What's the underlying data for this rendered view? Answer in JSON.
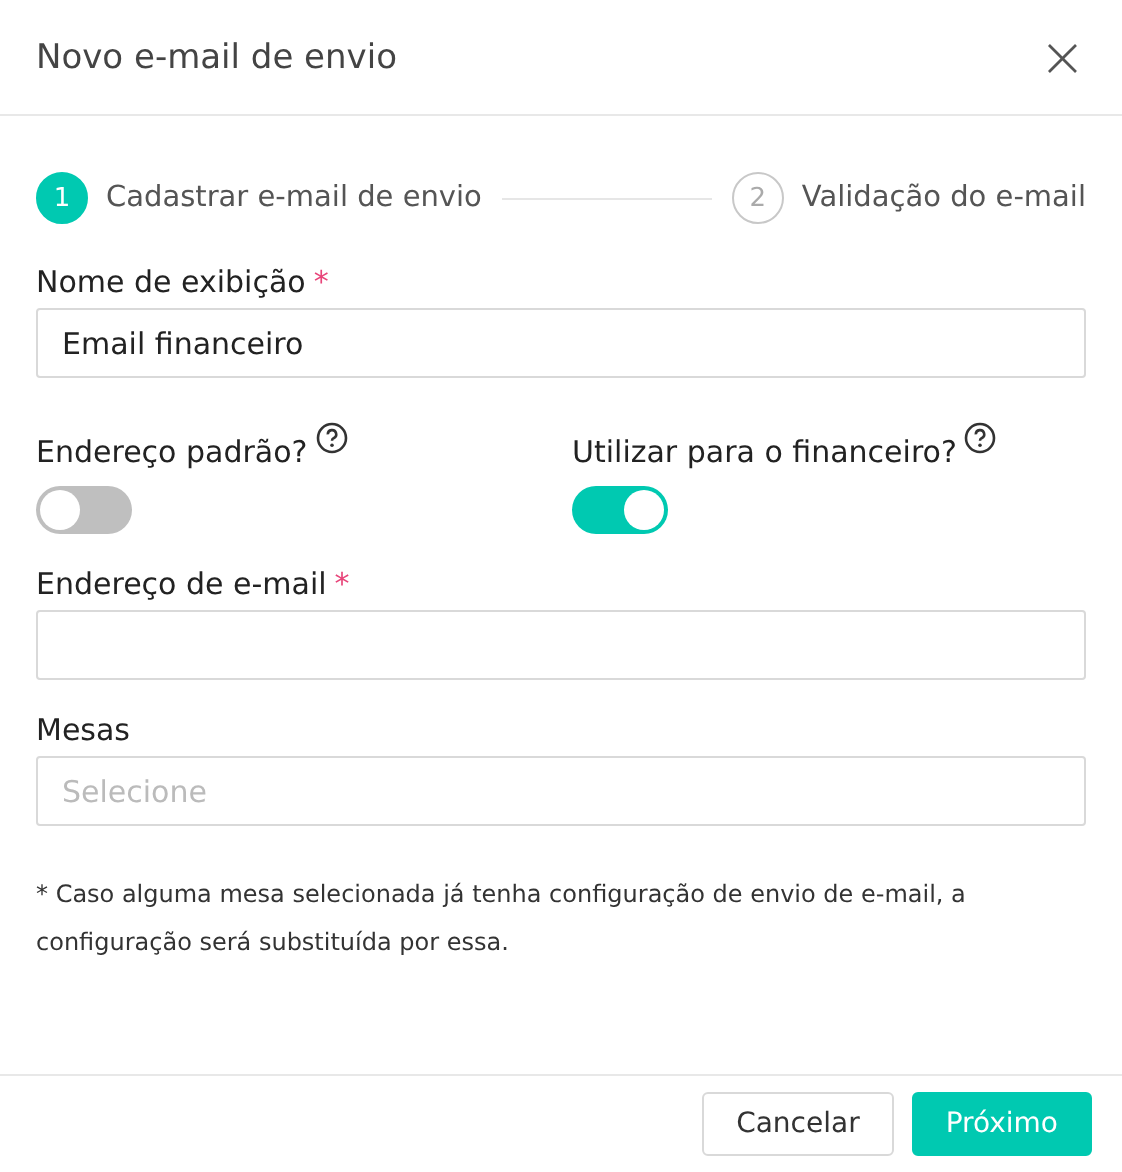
{
  "dialog": {
    "title": "Novo e-mail de envio",
    "close": "×"
  },
  "steps": [
    {
      "number": "1",
      "label": "Cadastrar e-mail de envio",
      "selected": true
    },
    {
      "number": "2",
      "label": "Validação do e-mail",
      "selected": false
    }
  ],
  "display_name": {
    "label": "Nome de exibição",
    "required_mark": "*",
    "value": "Email financeiro"
  },
  "toggles": [
    {
      "label": "Endereço padrão?",
      "on": false
    },
    {
      "label": "Utilizar para o financeiro?",
      "on": true
    }
  ],
  "email": {
    "label": "Endereço de e-mail",
    "required_mark": "*"
  },
  "desks": {
    "label": "Mesas",
    "placeholder": "Selecione"
  },
  "note": "* Caso alguma mesa selecionada já tenha configuração de envio de e-mail, a configuração será substituída por essa.",
  "buttons": [
    {
      "label": "Cancelar",
      "kind": "secondary"
    },
    {
      "label": "Próximo",
      "kind": "primary"
    }
  ]
}
